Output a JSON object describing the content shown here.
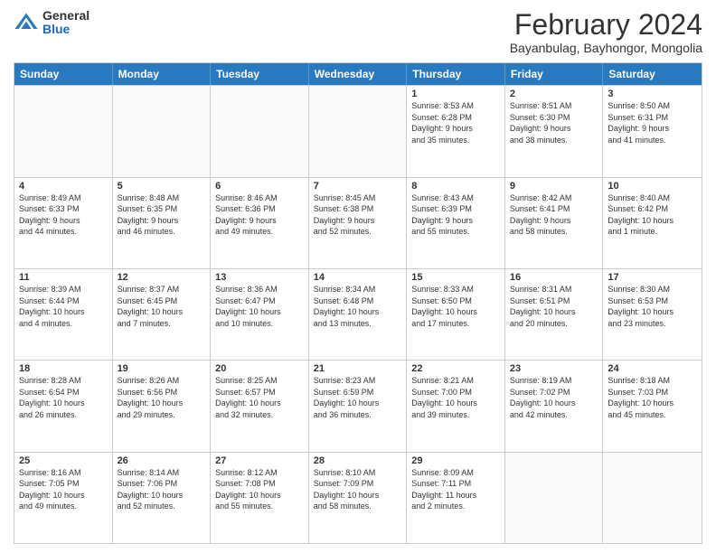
{
  "logo": {
    "general": "General",
    "blue": "Blue"
  },
  "header": {
    "month": "February 2024",
    "location": "Bayanbulag, Bayhongor, Mongolia"
  },
  "days": [
    "Sunday",
    "Monday",
    "Tuesday",
    "Wednesday",
    "Thursday",
    "Friday",
    "Saturday"
  ],
  "rows": [
    [
      {
        "day": "",
        "info": ""
      },
      {
        "day": "",
        "info": ""
      },
      {
        "day": "",
        "info": ""
      },
      {
        "day": "",
        "info": ""
      },
      {
        "day": "1",
        "info": "Sunrise: 8:53 AM\nSunset: 6:28 PM\nDaylight: 9 hours\nand 35 minutes."
      },
      {
        "day": "2",
        "info": "Sunrise: 8:51 AM\nSunset: 6:30 PM\nDaylight: 9 hours\nand 38 minutes."
      },
      {
        "day": "3",
        "info": "Sunrise: 8:50 AM\nSunset: 6:31 PM\nDaylight: 9 hours\nand 41 minutes."
      }
    ],
    [
      {
        "day": "4",
        "info": "Sunrise: 8:49 AM\nSunset: 6:33 PM\nDaylight: 9 hours\nand 44 minutes."
      },
      {
        "day": "5",
        "info": "Sunrise: 8:48 AM\nSunset: 6:35 PM\nDaylight: 9 hours\nand 46 minutes."
      },
      {
        "day": "6",
        "info": "Sunrise: 8:46 AM\nSunset: 6:36 PM\nDaylight: 9 hours\nand 49 minutes."
      },
      {
        "day": "7",
        "info": "Sunrise: 8:45 AM\nSunset: 6:38 PM\nDaylight: 9 hours\nand 52 minutes."
      },
      {
        "day": "8",
        "info": "Sunrise: 8:43 AM\nSunset: 6:39 PM\nDaylight: 9 hours\nand 55 minutes."
      },
      {
        "day": "9",
        "info": "Sunrise: 8:42 AM\nSunset: 6:41 PM\nDaylight: 9 hours\nand 58 minutes."
      },
      {
        "day": "10",
        "info": "Sunrise: 8:40 AM\nSunset: 6:42 PM\nDaylight: 10 hours\nand 1 minute."
      }
    ],
    [
      {
        "day": "11",
        "info": "Sunrise: 8:39 AM\nSunset: 6:44 PM\nDaylight: 10 hours\nand 4 minutes."
      },
      {
        "day": "12",
        "info": "Sunrise: 8:37 AM\nSunset: 6:45 PM\nDaylight: 10 hours\nand 7 minutes."
      },
      {
        "day": "13",
        "info": "Sunrise: 8:36 AM\nSunset: 6:47 PM\nDaylight: 10 hours\nand 10 minutes."
      },
      {
        "day": "14",
        "info": "Sunrise: 8:34 AM\nSunset: 6:48 PM\nDaylight: 10 hours\nand 13 minutes."
      },
      {
        "day": "15",
        "info": "Sunrise: 8:33 AM\nSunset: 6:50 PM\nDaylight: 10 hours\nand 17 minutes."
      },
      {
        "day": "16",
        "info": "Sunrise: 8:31 AM\nSunset: 6:51 PM\nDaylight: 10 hours\nand 20 minutes."
      },
      {
        "day": "17",
        "info": "Sunrise: 8:30 AM\nSunset: 6:53 PM\nDaylight: 10 hours\nand 23 minutes."
      }
    ],
    [
      {
        "day": "18",
        "info": "Sunrise: 8:28 AM\nSunset: 6:54 PM\nDaylight: 10 hours\nand 26 minutes."
      },
      {
        "day": "19",
        "info": "Sunrise: 8:26 AM\nSunset: 6:56 PM\nDaylight: 10 hours\nand 29 minutes."
      },
      {
        "day": "20",
        "info": "Sunrise: 8:25 AM\nSunset: 6:57 PM\nDaylight: 10 hours\nand 32 minutes."
      },
      {
        "day": "21",
        "info": "Sunrise: 8:23 AM\nSunset: 6:59 PM\nDaylight: 10 hours\nand 36 minutes."
      },
      {
        "day": "22",
        "info": "Sunrise: 8:21 AM\nSunset: 7:00 PM\nDaylight: 10 hours\nand 39 minutes."
      },
      {
        "day": "23",
        "info": "Sunrise: 8:19 AM\nSunset: 7:02 PM\nDaylight: 10 hours\nand 42 minutes."
      },
      {
        "day": "24",
        "info": "Sunrise: 8:18 AM\nSunset: 7:03 PM\nDaylight: 10 hours\nand 45 minutes."
      }
    ],
    [
      {
        "day": "25",
        "info": "Sunrise: 8:16 AM\nSunset: 7:05 PM\nDaylight: 10 hours\nand 49 minutes."
      },
      {
        "day": "26",
        "info": "Sunrise: 8:14 AM\nSunset: 7:06 PM\nDaylight: 10 hours\nand 52 minutes."
      },
      {
        "day": "27",
        "info": "Sunrise: 8:12 AM\nSunset: 7:08 PM\nDaylight: 10 hours\nand 55 minutes."
      },
      {
        "day": "28",
        "info": "Sunrise: 8:10 AM\nSunset: 7:09 PM\nDaylight: 10 hours\nand 58 minutes."
      },
      {
        "day": "29",
        "info": "Sunrise: 8:09 AM\nSunset: 7:11 PM\nDaylight: 11 hours\nand 2 minutes."
      },
      {
        "day": "",
        "info": ""
      },
      {
        "day": "",
        "info": ""
      }
    ]
  ]
}
